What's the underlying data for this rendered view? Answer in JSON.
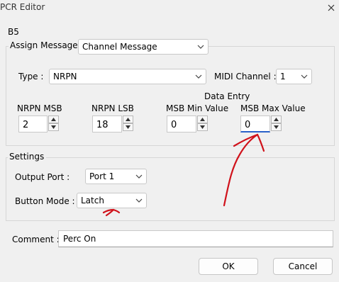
{
  "window": {
    "title": "PCR Editor",
    "close_icon": "close-icon"
  },
  "control_name": "B5",
  "assign": {
    "label": "Assign Message :",
    "value": "Channel Message"
  },
  "type": {
    "label": "Type :",
    "value": "NRPN"
  },
  "midi_channel": {
    "label": "MIDI Channel :",
    "value": "1"
  },
  "data_entry_label": "Data Entry",
  "nrpn_msb": {
    "label": "NRPN MSB",
    "value": "2"
  },
  "nrpn_lsb": {
    "label": "NRPN LSB",
    "value": "18"
  },
  "msb_min": {
    "label": "MSB Min Value",
    "value": "0"
  },
  "msb_max": {
    "label": "MSB Max Value",
    "value": "0"
  },
  "settings": {
    "title": "Settings",
    "output_port": {
      "label": "Output Port :",
      "value": "Port 1"
    },
    "button_mode": {
      "label": "Button Mode :",
      "value": "Latch"
    }
  },
  "comment": {
    "label": "Comment :",
    "value": "Perc On"
  },
  "buttons": {
    "ok": "OK",
    "cancel": "Cancel"
  },
  "colors": {
    "annotation": "#d0121b",
    "focus": "#2a62c9",
    "background": "#f0f0f0"
  }
}
